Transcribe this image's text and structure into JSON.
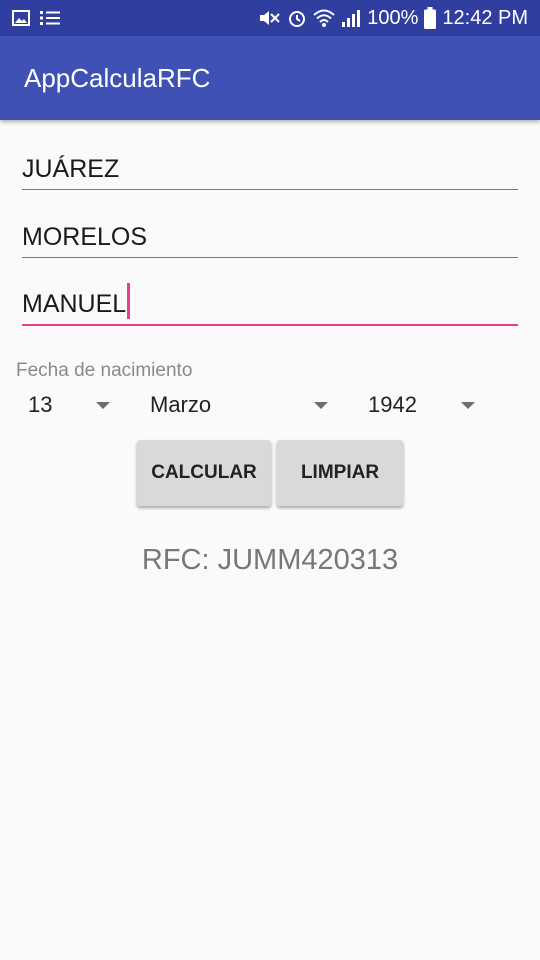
{
  "status_bar": {
    "battery": "100%",
    "time": "12:42 PM",
    "icons": [
      "image-icon",
      "list-icon",
      "mute-icon",
      "alarm-icon",
      "wifi-icon",
      "signal-icon",
      "battery-icon"
    ]
  },
  "app_bar": {
    "title": "AppCalculaRFC"
  },
  "form": {
    "apellido_paterno": "JUÁREZ",
    "apellido_materno": "MORELOS",
    "nombre": "MANUEL",
    "fecha_label": "Fecha de nacimiento",
    "dia": "13",
    "mes": "Marzo",
    "anio": "1942"
  },
  "buttons": {
    "calcular": "CALCULAR",
    "limpiar": "LIMPIAR"
  },
  "result": {
    "rfc": "RFC: JUMM420313"
  },
  "colors": {
    "status_bar": "#303f9f",
    "app_bar": "#3f51b5",
    "accent": "#e83e8c"
  }
}
